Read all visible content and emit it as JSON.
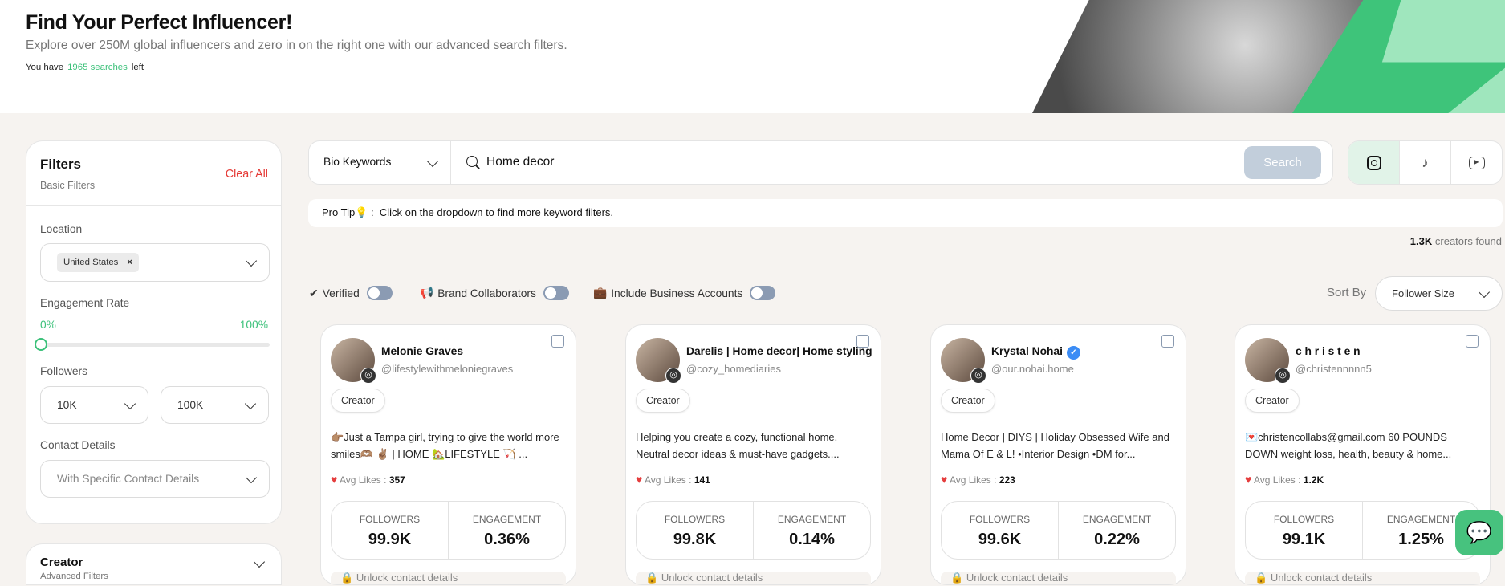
{
  "header": {
    "title": "Find Your Perfect Influencer!",
    "subtitle": "Explore over 250M global influencers and zero in on the right one with our advanced search filters.",
    "quota_prefix": "You have",
    "quota_link": "1965 searches",
    "quota_suffix": "left"
  },
  "filters": {
    "title": "Filters",
    "subtitle": "Basic Filters",
    "clear_all": "Clear All",
    "location_label": "Location",
    "location_chip": "United States",
    "engagement_label": "Engagement Rate",
    "engagement_min": "0%",
    "engagement_max": "100%",
    "followers_label": "Followers",
    "followers_min": "10K",
    "followers_max": "100K",
    "contact_label": "Contact Details",
    "contact_placeholder": "With Specific Contact Details",
    "advanced_title": "Creator",
    "advanced_subtitle": "Advanced Filters"
  },
  "search": {
    "type": "Bio Keywords",
    "query": "Home decor",
    "button": "Search",
    "platforms": [
      "instagram",
      "tiktok",
      "youtube"
    ],
    "active_platform": "instagram"
  },
  "protip": {
    "label": "Pro Tip",
    "text": "Click on the dropdown to find more keyword filters."
  },
  "results": {
    "count": "1.3K",
    "count_suffix": "creators found"
  },
  "options": {
    "verified": "Verified",
    "brand": "Brand Collaborators",
    "business": "Include Business Accounts",
    "sort_label": "Sort By",
    "sort_value": "Follower Size"
  },
  "cards": [
    {
      "name": "Melonie Graves",
      "handle": "@lifestylewithmeloniegraves",
      "tag": "Creator",
      "bio": "👉🏽Just a Tampa girl, trying to give the world more smiles🫶🏽 ✌🏽 | HOME 🏡LIFESTYLE 🏹 ...",
      "likes_label": "Avg Likes :",
      "likes": "357",
      "followers_label": "FOLLOWERS",
      "followers": "99.9K",
      "engagement_label": "ENGAGEMENT",
      "engagement": "0.36%",
      "unlock": "Unlock contact details",
      "verified": false
    },
    {
      "name": "Darelis | Home decor| Home styling",
      "handle": "@cozy_homediaries",
      "tag": "Creator",
      "bio": "Helping you create a cozy, functional home. Neutral decor ideas & must-have gadgets....",
      "likes_label": "Avg Likes :",
      "likes": "141",
      "followers_label": "FOLLOWERS",
      "followers": "99.8K",
      "engagement_label": "ENGAGEMENT",
      "engagement": "0.14%",
      "unlock": "Unlock contact details",
      "verified": false
    },
    {
      "name": "Krystal Nohai",
      "handle": "@our.nohai.home",
      "tag": "Creator",
      "bio": "Home Decor | DIYS | Holiday Obsessed Wife and Mama Of E & L! •Interior Design •DM for...",
      "likes_label": "Avg Likes :",
      "likes": "223",
      "followers_label": "FOLLOWERS",
      "followers": "99.6K",
      "engagement_label": "ENGAGEMENT",
      "engagement": "0.22%",
      "unlock": "Unlock contact details",
      "verified": true
    },
    {
      "name": "c h r i s t e n",
      "handle": "@christennnnn5",
      "tag": "Creator",
      "bio": "💌christencollabs@gmail.com 60 POUNDS DOWN weight loss, health, beauty & home...",
      "likes_label": "Avg Likes :",
      "likes": "1.2K",
      "followers_label": "FOLLOWERS",
      "followers": "99.1K",
      "engagement_label": "ENGAGEMENT",
      "engagement": "1.25%",
      "unlock": "Unlock contact details",
      "verified": false
    }
  ],
  "colors": {
    "accent": "#3cc17a",
    "danger": "#e53935",
    "background": "#f6f3f0",
    "search_button": "#c2cedb"
  }
}
